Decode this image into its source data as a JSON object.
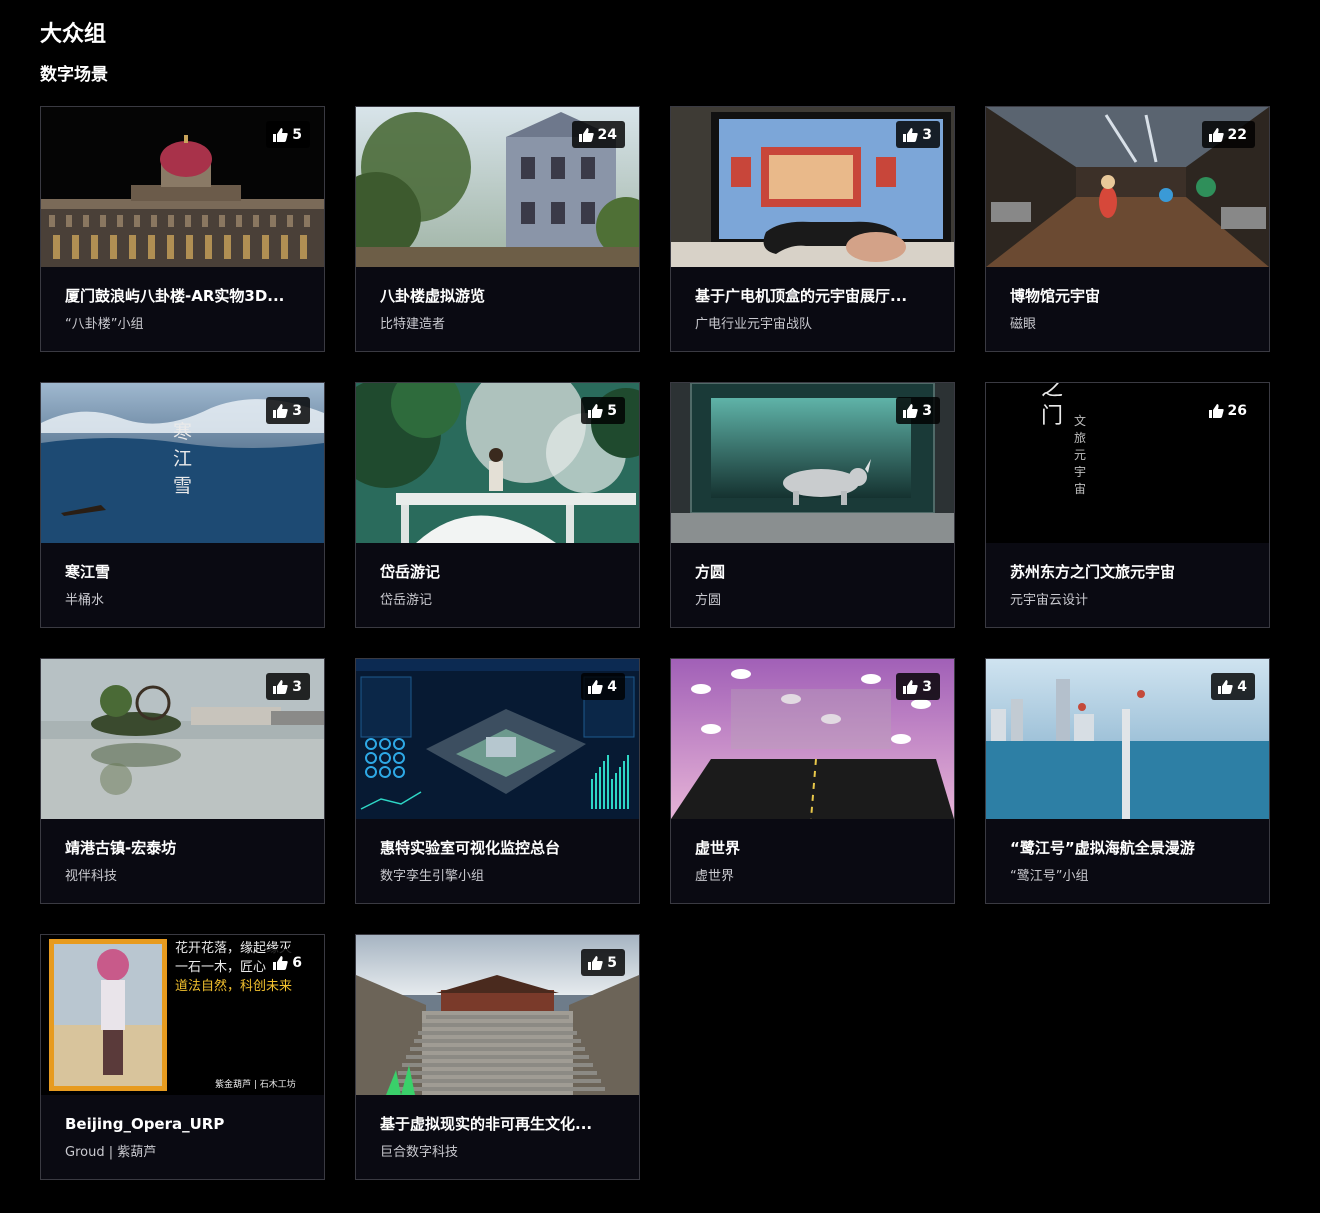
{
  "group_title": "大众组",
  "section_title": "数字场景",
  "colors": {
    "background": "#000000",
    "card_background": "#0a0a12",
    "card_border": "#3a3a42",
    "author_text": "#c9c9cf"
  },
  "cards": [
    {
      "title": "厦门鼓浪屿八卦楼-AR实物3D...",
      "author": "“八卦楼”小组",
      "likes": "5",
      "thumb": "dome-building"
    },
    {
      "title": "八卦楼虚拟游览",
      "author": "比特建造者",
      "likes": "24",
      "thumb": "sunlit-building"
    },
    {
      "title": "基于广电机顶盒的元宇宙展厅...",
      "author": "广电行业元宇宙战队",
      "likes": "3",
      "thumb": "tv-gamepad"
    },
    {
      "title": "博物馆元宇宙",
      "author": "磁眼",
      "likes": "22",
      "thumb": "museum-hall"
    },
    {
      "title": "寒江雪",
      "author": "半桶水",
      "likes": "3",
      "thumb": "snowy-river",
      "overlay": [
        "寒",
        "江",
        "雪"
      ]
    },
    {
      "title": "岱岳游记",
      "author": "岱岳游记",
      "likes": "5",
      "thumb": "forest-bridge"
    },
    {
      "title": "方圆",
      "author": "方圆",
      "likes": "3",
      "thumb": "rhino-case"
    },
    {
      "title": "苏州东方之门文旅元宇宙",
      "author": "元宇宙云设计",
      "likes": "26",
      "thumb": "dark-poster",
      "overlay_big": [
        "之",
        "门"
      ],
      "overlay_small": [
        "文",
        "旅",
        "元",
        "宇",
        "宙"
      ]
    },
    {
      "title": "靖港古镇-宏泰坊",
      "author": "视伴科技",
      "likes": "3",
      "thumb": "lake-reflection"
    },
    {
      "title": "惠特实验室可视化监控总台",
      "author": "数字孪生引擎小组",
      "likes": "4",
      "thumb": "dashboard"
    },
    {
      "title": "虚世界",
      "author": "虚世界",
      "likes": "3",
      "thumb": "pink-sky"
    },
    {
      "title": "“鹭江号”虚拟海航全景漫游",
      "author": "“鹭江号”小组",
      "likes": "4",
      "thumb": "sea-city"
    },
    {
      "title": "Beijing_Opera_URP",
      "author": "Groud | 紫葫芦",
      "likes": "6",
      "thumb": "opera-poster",
      "overlay_lines": [
        "花开花落，缘起缘灭",
        "一石一木，匠心",
        "道法自然，科创未来"
      ],
      "overlay_credit": "紫金葫芦 | 石木工坊"
    },
    {
      "title": "基于虚拟现实的非可再生文化...",
      "author": "巨合数字科技",
      "likes": "5",
      "thumb": "palace-steps"
    }
  ]
}
